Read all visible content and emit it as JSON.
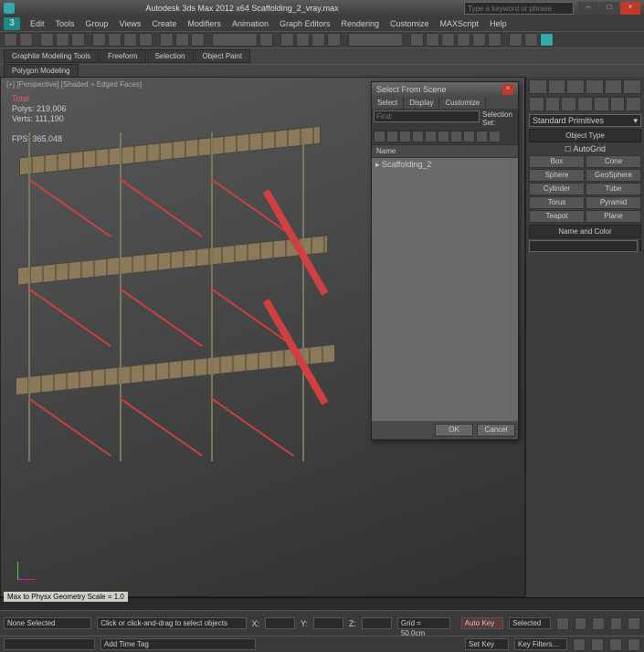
{
  "titlebar": {
    "title": "Autodesk 3ds Max 2012 x64   Scaffolding_2_vray.max",
    "search_placeholder": "Type a keyword or phrase"
  },
  "menu": [
    "Edit",
    "Tools",
    "Group",
    "Views",
    "Create",
    "Modifiers",
    "Animation",
    "Graph Editors",
    "Rendering",
    "Customize",
    "MAXScript",
    "Help"
  ],
  "logo": "3",
  "ribbon": [
    "Graphite Modeling Tools",
    "Freeform",
    "Selection",
    "Object Paint"
  ],
  "ribbon_sub": "Polygon Modeling",
  "viewport": {
    "label": "[+] [Perspective] [Shaded + Edged Faces]",
    "stats": {
      "l1": "Total",
      "polys": "Polys:   219,006",
      "verts": "Verts:   111,190",
      "fps": "FPS:   365.048"
    }
  },
  "dialog": {
    "title": "Select From Scene",
    "tabs": [
      "Select",
      "Display",
      "Customize"
    ],
    "find_placeholder": "Find:",
    "selset": "Selection Set:",
    "list_header": "Name",
    "items": [
      "Scaffolding_2"
    ],
    "ok": "OK",
    "cancel": "Cancel"
  },
  "cmdpanel": {
    "dropdown": "Standard Primitives",
    "rollout1": "Object Type",
    "autogrid": "AutoGrid",
    "prims": [
      "Box",
      "Cone",
      "Sphere",
      "GeoSphere",
      "Cylinder",
      "Tube",
      "Torus",
      "Pyramid",
      "Teapot",
      "Plane"
    ],
    "rollout2": "Name and Color"
  },
  "physcale": "Max to Physx Geometry Scale = 1.0",
  "status": {
    "none": "None Selected",
    "prompt": "Click or click-and-drag to select objects",
    "x": "X:",
    "y": "Y:",
    "z": "Z:",
    "grid": "Grid = 50.0cm",
    "addtag": "Add Time Tag",
    "autokey": "Auto Key",
    "setkey": "Set Key",
    "selected": "Selected",
    "keyfilters": "Key Filters..."
  }
}
